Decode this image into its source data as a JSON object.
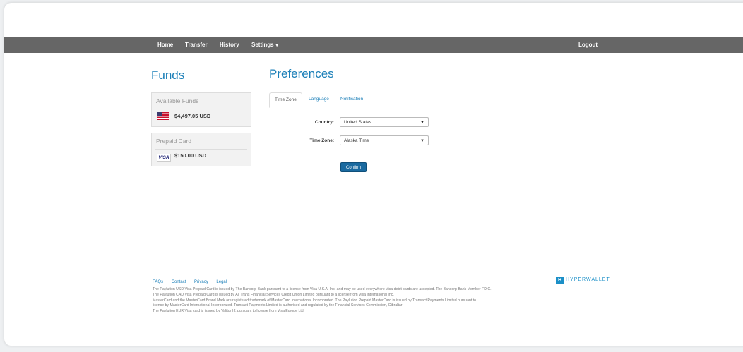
{
  "nav": {
    "home": "Home",
    "transfer": "Transfer",
    "history": "History",
    "settings": "Settings",
    "logout": "Logout"
  },
  "funds": {
    "title": "Funds",
    "available": {
      "title": "Available Funds",
      "amount": "$4,497.05 USD",
      "icon": "us-flag-icon"
    },
    "prepaid": {
      "title": "Prepaid Card",
      "amount": "$150.00 USD",
      "icon": "visa-icon",
      "icon_text": "VISA"
    }
  },
  "preferences": {
    "title": "Preferences",
    "tabs": [
      "Time Zone",
      "Language",
      "Notification"
    ],
    "active_tab": "Time Zone",
    "country_label": "Country:",
    "country_value": "United States",
    "timezone_label": "Time Zone:",
    "timezone_value": "Alaska Time",
    "confirm_label": "Confirm"
  },
  "footer": {
    "links": [
      "FAQs",
      "Contact",
      "Privacy",
      "Legal"
    ],
    "brand_mark": "H",
    "brand": "HYPERWALLET",
    "legal": [
      "The Paylution USD Visa Prepaid Card is issued by The Bancorp Bank pursuant to a license from Visa U.S.A. Inc. and may be used everywhere Visa debit cards are accepted. The Bancorp Bank Member FDIC.",
      "The Paylution CAD Visa Prepaid Card is issued by All Trans Financial Services Credit Union Limited pursuant to a license from Visa International Inc.",
      "MasterCard and the MasterCard Brand Mark are registered trademark of MasterCard International Incorporated. The Paylution Prepaid MasterCard is issued by Transact Payments Limited pursuant to",
      "licence by MasterCard International Incorporated. Transact Payments Limited is authorised and regulated by the Financial Services Commission, Gibraltar",
      "The Paylution EUR Visa card is issued by Valitor hf. pursuant to license from Visa Europe Ltd."
    ]
  },
  "colors": {
    "accent": "#1b7fb8",
    "navbar": "#666666",
    "button": "#1a6aa0"
  }
}
